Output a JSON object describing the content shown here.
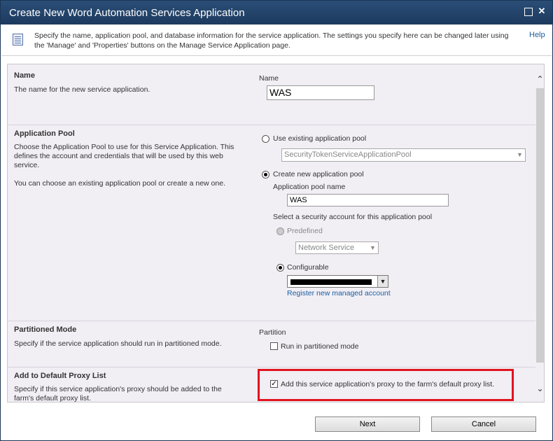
{
  "window": {
    "title": "Create New Word Automation Services Application"
  },
  "info": {
    "text": "Specify the name, application pool, and database information for the service application. The settings you specify here can be changed later using the 'Manage' and 'Properties' buttons on the Manage Service Application page.",
    "help": "Help"
  },
  "name_section": {
    "title": "Name",
    "desc": "The name for the new service application.",
    "field_label": "Name",
    "value": "WAS"
  },
  "pool_section": {
    "title": "Application Pool",
    "desc1": "Choose the Application Pool to use for this Service Application. This defines the account and credentials that will be used by this web service.",
    "desc2": "You can choose an existing application pool or create a new one.",
    "use_existing_label": "Use existing application pool",
    "existing_pool_value": "SecurityTokenServiceApplicationPool",
    "create_new_label": "Create new application pool",
    "pool_name_label": "Application pool name",
    "pool_name_value": "WAS",
    "security_label": "Select a security account for this application pool",
    "predefined_label": "Predefined",
    "predefined_value": "Network Service",
    "configurable_label": "Configurable",
    "register_link": "Register new managed account"
  },
  "partition_section": {
    "title": "Partitioned Mode",
    "desc": "Specify if the service application should run in partitioned mode.",
    "field_label": "Partition",
    "checkbox_label": "Run in partitioned mode",
    "checked": false
  },
  "proxy_section": {
    "title": "Add to Default Proxy List",
    "desc": "Specify if this service application's proxy should be added to the farm's default proxy list.",
    "checkbox_label": "Add this service application's proxy to the farm's default proxy list.",
    "checked": true
  },
  "footer": {
    "next": "Next",
    "cancel": "Cancel"
  },
  "colors": {
    "title_bar": "#1d3a5e",
    "highlight": "#e0141e",
    "link": "#1a5fa0"
  }
}
